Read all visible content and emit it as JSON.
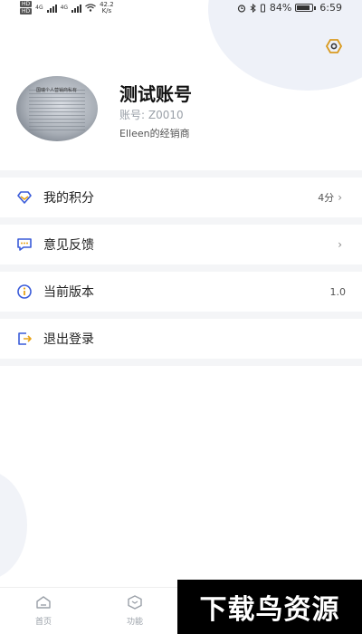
{
  "status_bar": {
    "hd1": "HD",
    "hd2": "HD",
    "net1": "4G",
    "net2": "4G",
    "speed_value": "42.2",
    "speed_unit": "K/s",
    "battery": "84%",
    "time": "6:59"
  },
  "profile": {
    "name": "测试账号",
    "account_id": "账号: Z0010",
    "dealer": "Elleen的经销商",
    "avatar_text": "国瑞个人营销商私有"
  },
  "menu": {
    "points": {
      "label": "我的积分",
      "value": "4分"
    },
    "feedback": {
      "label": "意见反馈"
    },
    "version": {
      "label": "当前版本",
      "value": "1.0"
    },
    "logout": {
      "label": "退出登录"
    }
  },
  "nav": {
    "home": "首页",
    "features": "功能"
  },
  "watermark": "下载鸟资源",
  "colors": {
    "accent": "#3a5bd9",
    "icon_gray": "#6b7280",
    "divider": "#f4f5f7"
  }
}
